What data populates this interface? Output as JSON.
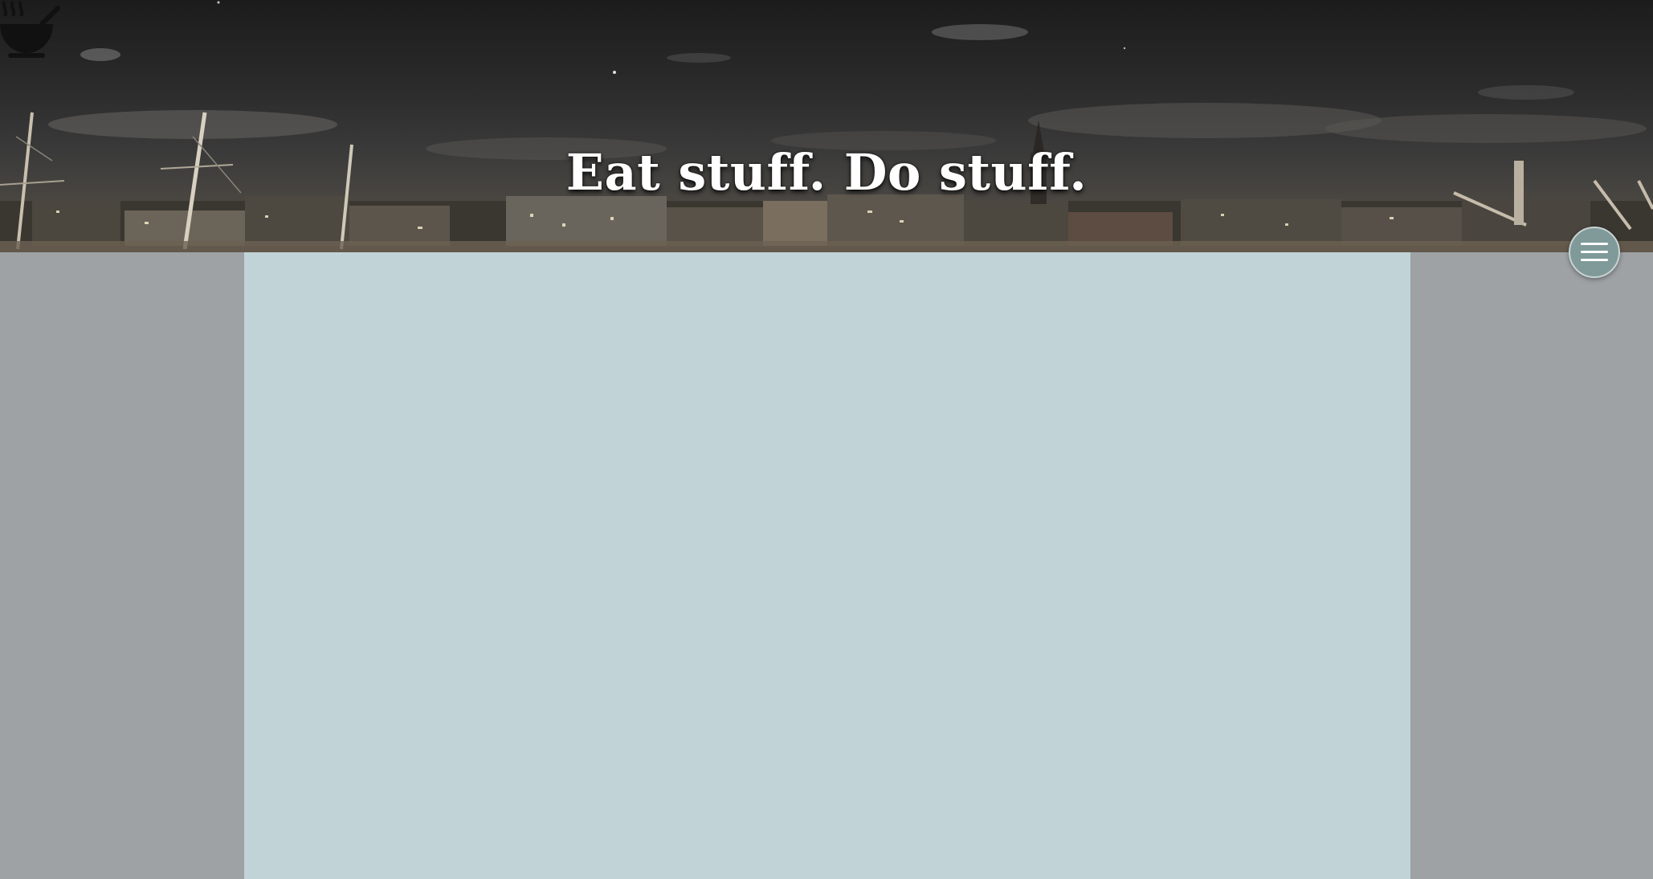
{
  "hero": {
    "title": "Eat stuff. Do stuff."
  },
  "logo": {
    "icon": "steaming-bowl-icon"
  },
  "menu": {
    "icon": "hamburger-menu-icon",
    "color": "#7f9a99"
  },
  "colors": {
    "page_background": "#9ea2a5",
    "content_background": "#c1d3d7"
  }
}
